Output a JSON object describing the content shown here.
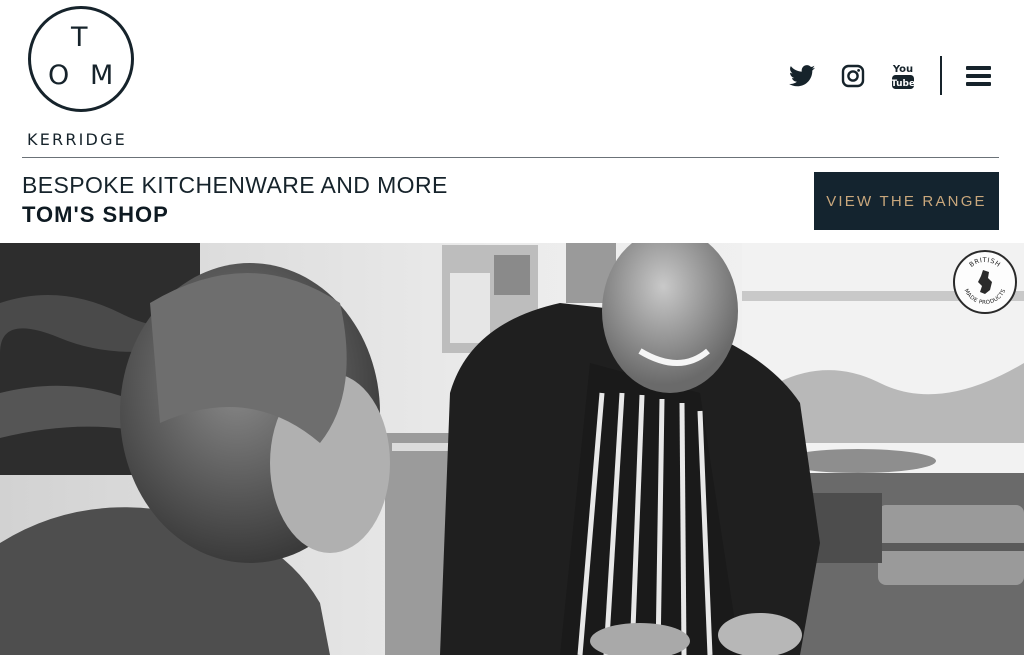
{
  "header": {
    "logo": {
      "letter_t": "T",
      "letter_o": "O",
      "letter_m": "M",
      "wordmark": "KERRIDGE"
    },
    "social": [
      "twitter-icon",
      "instagram-icon",
      "youtube-icon"
    ],
    "youtube_label_top": "You",
    "youtube_label_bottom": "Tube",
    "menu_icon": "hamburger-menu-icon"
  },
  "promo": {
    "subtitle": "BESPOKE KITCHENWARE AND MORE",
    "title": "TOM'S SHOP",
    "cta_label": "VIEW THE RANGE"
  },
  "hero": {
    "badge_text_top": "BRITISH",
    "badge_text_bottom": "MADE PRODUCTS"
  },
  "colors": {
    "navy": "#16232b",
    "cta_bg": "#14242f",
    "cta_text": "#c9a77c",
    "rule": "#6b7278"
  }
}
